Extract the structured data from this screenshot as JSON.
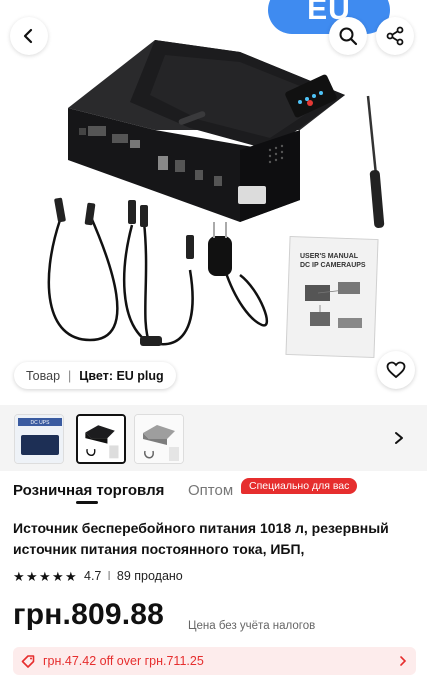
{
  "header": {
    "badge_text": "EU",
    "back_icon": "chevron-left-icon",
    "search_icon": "search-icon",
    "share_icon": "share-icon"
  },
  "product_image": {
    "manual_title_line1": "USER'S MANUAL",
    "manual_title_line2": "DC IP CAMERAUPS"
  },
  "variant": {
    "label": "Товар",
    "separator": "|",
    "value": "Цвет: EU plug"
  },
  "thumbnails": [
    {
      "name": "thumbnail-1",
      "caption": "DC UPS"
    },
    {
      "name": "thumbnail-2",
      "caption": ""
    },
    {
      "name": "thumbnail-3",
      "caption": ""
    }
  ],
  "tabs": {
    "retail": "Розничная торговля",
    "wholesale": "Оптом",
    "special_badge": "Специально для вас"
  },
  "product": {
    "title": "Источник бесперебойного питания 1018 л, резервный источник питания постоянного тока, ИБП, маршрутизато…",
    "rating": "4.7",
    "rating_divider": "I",
    "sold": "89 продано",
    "price": "грн.809.88",
    "price_note": "Цена без учёта налогов"
  },
  "coupon": {
    "text": "грн.47.42 off over грн.711.25"
  },
  "colors": {
    "accent_red": "#e62e2e",
    "badge_blue": "#3f8bf0"
  }
}
